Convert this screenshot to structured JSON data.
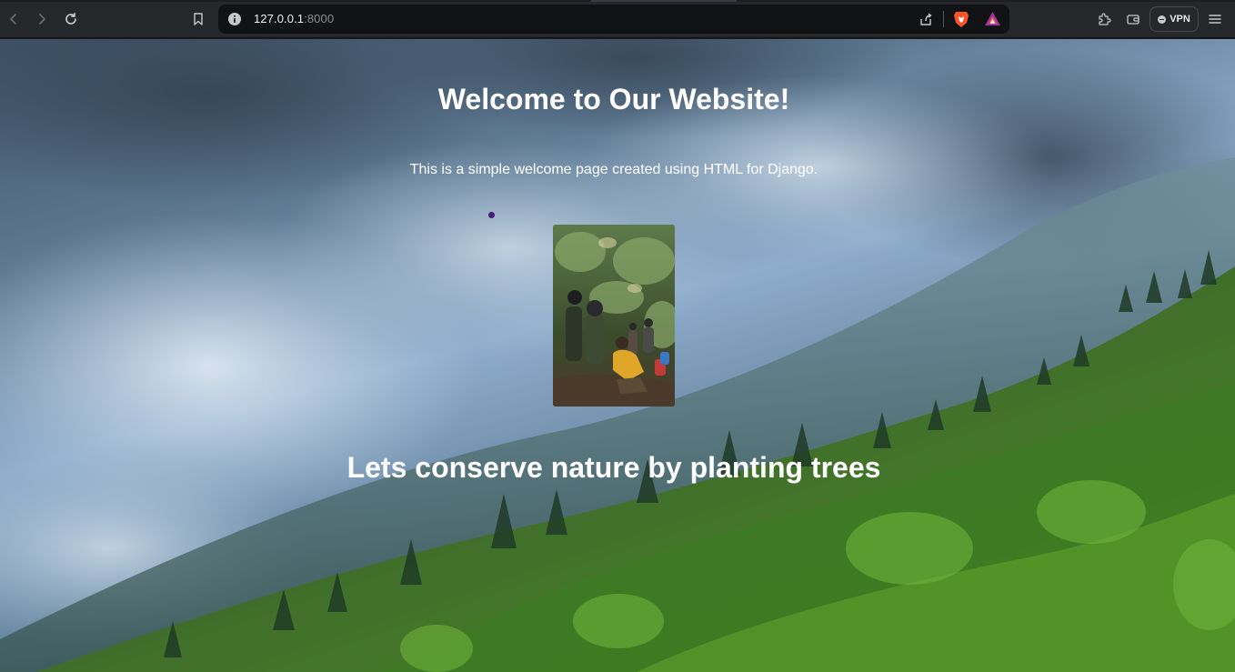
{
  "browser": {
    "url_host": "127.0.0.1",
    "url_port": ":8000",
    "vpn_label": "VPN"
  },
  "page": {
    "heading": "Welcome to Our Website!",
    "subtext": "This is a simple welcome page created using HTML for Django.",
    "tagline": "Lets conserve nature by planting trees"
  },
  "icons": {
    "back": "back-arrow-icon",
    "forward": "forward-arrow-icon",
    "reload": "reload-icon",
    "bookmark": "bookmark-icon",
    "site_info": "info-icon",
    "share": "share-icon",
    "brave": "brave-shields-icon",
    "rewards": "brave-rewards-icon",
    "extensions": "extensions-puzzle-icon",
    "wallet": "wallet-icon",
    "menu": "hamburger-menu-icon"
  },
  "colors": {
    "chrome": "#26272b",
    "urlbar": "#111214",
    "text": "#ffffff"
  }
}
